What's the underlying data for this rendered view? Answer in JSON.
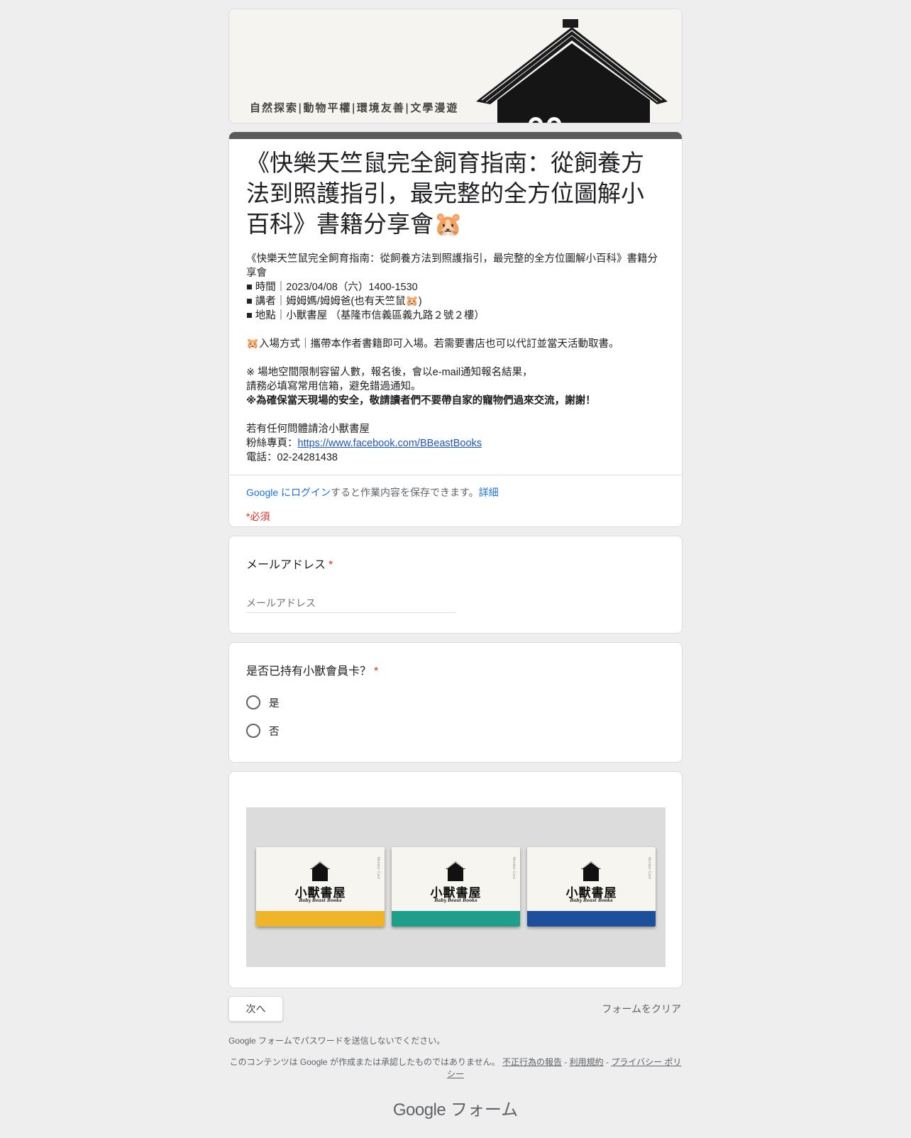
{
  "banner": {
    "tagline": "自然探索|動物平權|環境友善|文學漫遊"
  },
  "form": {
    "title": "《快樂天竺鼠完全飼育指南：從飼養方法到照護指引，最完整的全方位圖解小百科》書籍分享會🐹",
    "description_lines": {
      "l1": "《快樂天竺鼠完全飼育指南：從飼養方法到照護指引，最完整的全方位圖解小百科》書籍分享會",
      "l2": "■ 時間｜2023/04/08（六）1400-1530",
      "l3": "■ 講者｜姆姆媽/姆姆爸(也有天竺鼠🐹)",
      "l4": "■ 地點｜小獸書屋 （基隆市信義區義九路２號２樓）",
      "l5": "🐹入場方式｜攜帶本作者書籍即可入場。若需要書店也可以代訂並當天活動取書。",
      "l6": "※ 場地空間限制容留人數，報名後，會以e-mail通知報名結果，",
      "l7": "請務必填寫常用信箱，避免錯過通知。",
      "l8": "※為確保當天現場的安全，敬請讀者們不要帶自家的寵物們過來交流，謝謝！",
      "l9": "若有任何問體請洽小獸書屋",
      "l10_prefix": "粉絲專頁：",
      "l10_link": "https://www.facebook.com/BBeastBooks",
      "l11": "電話：02-24281438"
    },
    "login": {
      "link": "Google にログイン",
      "text": "すると作業内容を保存できます。",
      "detail": "詳細"
    },
    "required_note": "*必須"
  },
  "questions": {
    "email": {
      "title": "メールアドレス",
      "required": "*",
      "placeholder": "メールアドレス"
    },
    "member": {
      "title": "是否已持有小獸會員卡？",
      "required": "*",
      "options": [
        "是",
        "否"
      ]
    }
  },
  "member_cards": {
    "brand": "小獸書屋",
    "sub": "Baby Beast Books",
    "vertical": "Member Card",
    "colors": [
      "#f0b429",
      "#1f9e8a",
      "#1e4f9a"
    ]
  },
  "footer": {
    "next": "次へ",
    "clear": "フォームをクリア",
    "password_note": "Google フォームでパスワードを送信しないでください。",
    "disclaimer": "このコンテンツは Google が作成または承認したものではありません。",
    "report": "不正行為の報告",
    "terms": "利用規約",
    "privacy": "プライバシー ポリシー",
    "separator": " - ",
    "logo_google": "Google",
    "logo_forms": "フォーム"
  }
}
